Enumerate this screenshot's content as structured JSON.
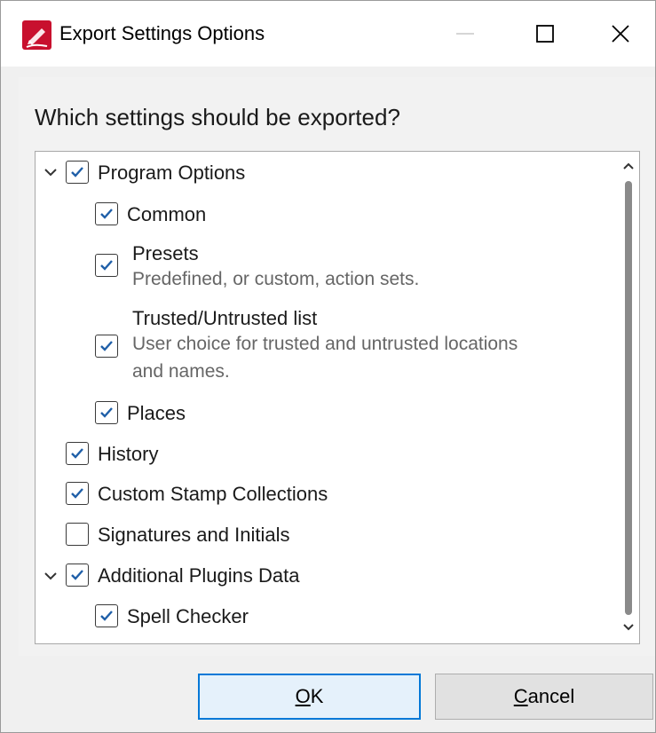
{
  "window": {
    "title": "Export Settings Options",
    "icon": "pdf-app-icon",
    "controls": [
      "minimize-icon",
      "maximize-icon",
      "close-icon"
    ]
  },
  "question": "Which settings should be exported?",
  "tree": [
    {
      "label": "Program Options",
      "checked": true,
      "expandable": true,
      "expanded": true,
      "level": 0
    },
    {
      "label": "Common",
      "checked": true,
      "level": 1
    },
    {
      "label": "Presets",
      "description": "Predefined, or custom, action sets.",
      "checked": true,
      "level": 1
    },
    {
      "label": "Trusted/Untrusted list",
      "description_line1": "User choice for trusted and untrusted locations",
      "description_line2": "and names.",
      "checked": true,
      "level": 1
    },
    {
      "label": "Places",
      "checked": true,
      "level": 1
    },
    {
      "label": "History",
      "checked": true,
      "level": 0
    },
    {
      "label": "Custom Stamp Collections",
      "checked": true,
      "level": 0
    },
    {
      "label": "Signatures and Initials",
      "checked": false,
      "level": 0
    },
    {
      "label": "Additional Plugins Data",
      "checked": true,
      "expandable": true,
      "expanded": true,
      "level": 0
    },
    {
      "label": "Spell Checker",
      "checked": true,
      "level": 1
    }
  ],
  "buttons": {
    "ok": {
      "mnemonic": "O",
      "rest": "K"
    },
    "cancel": {
      "mnemonic": "C",
      "rest": "ancel"
    }
  },
  "colors": {
    "check": "#1f5fa8",
    "app_icon": "#c8102e",
    "default_button_border": "#0078d7"
  }
}
